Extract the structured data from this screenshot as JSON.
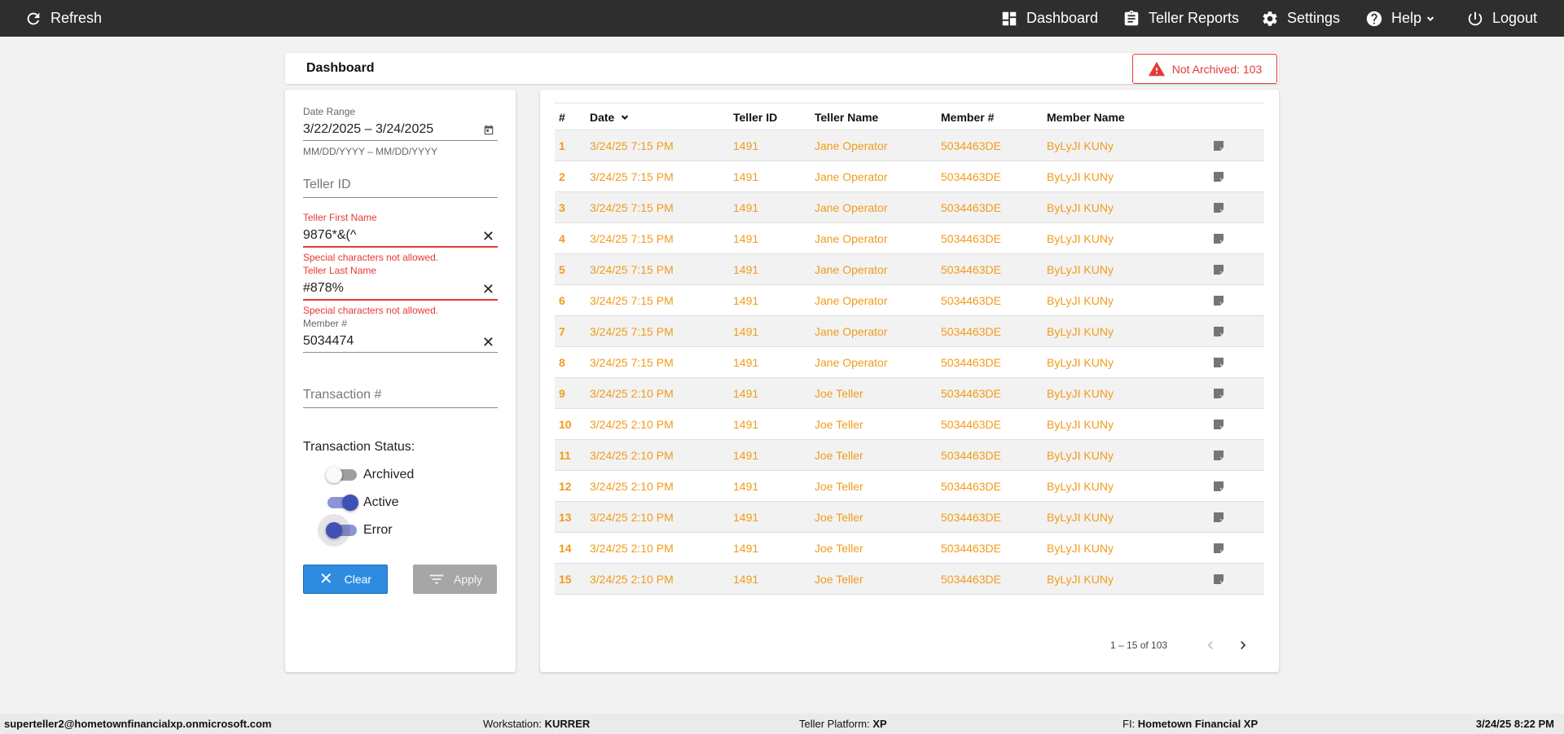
{
  "topbar": {
    "refresh_label": "Refresh",
    "nav": {
      "dashboard": "Dashboard",
      "teller_reports": "Teller Reports",
      "settings": "Settings",
      "help": "Help",
      "logout": "Logout"
    }
  },
  "header": {
    "title": "Dashboard",
    "not_archived": "Not Archived: 103"
  },
  "filters": {
    "date_range": {
      "label": "Date Range",
      "value": "3/22/2025 – 3/24/2025",
      "hint": "MM/DD/YYYY – MM/DD/YYYY"
    },
    "teller_id": {
      "placeholder": "Teller ID"
    },
    "teller_first_name": {
      "label": "Teller First Name",
      "value": "9876*&(^",
      "error": "Special characters not allowed."
    },
    "teller_last_name": {
      "label": "Teller Last Name",
      "value": "#878%",
      "error": "Special characters not allowed."
    },
    "member_number": {
      "label": "Member #",
      "value": "5034474"
    },
    "transaction_number": {
      "placeholder": "Transaction #"
    },
    "status": {
      "title": "Transaction Status:",
      "archived": "Archived",
      "active": "Active",
      "error": "Error"
    },
    "clear_label": "Clear",
    "apply_label": "Apply"
  },
  "table": {
    "columns": {
      "num": "#",
      "date": "Date",
      "teller_id": "Teller ID",
      "teller_name": "Teller Name",
      "member_num": "Member #",
      "member_name": "Member Name"
    },
    "rows": [
      {
        "num": "1",
        "date": "3/24/25 7:15 PM",
        "teller_id": "1491",
        "teller_name": "Jane Operator",
        "member_num": "5034463DE",
        "member_name": "ByLyJI KUNy"
      },
      {
        "num": "2",
        "date": "3/24/25 7:15 PM",
        "teller_id": "1491",
        "teller_name": "Jane Operator",
        "member_num": "5034463DE",
        "member_name": "ByLyJI KUNy"
      },
      {
        "num": "3",
        "date": "3/24/25 7:15 PM",
        "teller_id": "1491",
        "teller_name": "Jane Operator",
        "member_num": "5034463DE",
        "member_name": "ByLyJI KUNy"
      },
      {
        "num": "4",
        "date": "3/24/25 7:15 PM",
        "teller_id": "1491",
        "teller_name": "Jane Operator",
        "member_num": "5034463DE",
        "member_name": "ByLyJI KUNy"
      },
      {
        "num": "5",
        "date": "3/24/25 7:15 PM",
        "teller_id": "1491",
        "teller_name": "Jane Operator",
        "member_num": "5034463DE",
        "member_name": "ByLyJI KUNy"
      },
      {
        "num": "6",
        "date": "3/24/25 7:15 PM",
        "teller_id": "1491",
        "teller_name": "Jane Operator",
        "member_num": "5034463DE",
        "member_name": "ByLyJI KUNy"
      },
      {
        "num": "7",
        "date": "3/24/25 7:15 PM",
        "teller_id": "1491",
        "teller_name": "Jane Operator",
        "member_num": "5034463DE",
        "member_name": "ByLyJI KUNy"
      },
      {
        "num": "8",
        "date": "3/24/25 7:15 PM",
        "teller_id": "1491",
        "teller_name": "Jane Operator",
        "member_num": "5034463DE",
        "member_name": "ByLyJI KUNy"
      },
      {
        "num": "9",
        "date": "3/24/25 2:10 PM",
        "teller_id": "1491",
        "teller_name": "Joe Teller",
        "member_num": "5034463DE",
        "member_name": "ByLyJI KUNy"
      },
      {
        "num": "10",
        "date": "3/24/25 2:10 PM",
        "teller_id": "1491",
        "teller_name": "Joe Teller",
        "member_num": "5034463DE",
        "member_name": "ByLyJI KUNy"
      },
      {
        "num": "11",
        "date": "3/24/25 2:10 PM",
        "teller_id": "1491",
        "teller_name": "Joe Teller",
        "member_num": "5034463DE",
        "member_name": "ByLyJI KUNy"
      },
      {
        "num": "12",
        "date": "3/24/25 2:10 PM",
        "teller_id": "1491",
        "teller_name": "Joe Teller",
        "member_num": "5034463DE",
        "member_name": "ByLyJI KUNy"
      },
      {
        "num": "13",
        "date": "3/24/25 2:10 PM",
        "teller_id": "1491",
        "teller_name": "Joe Teller",
        "member_num": "5034463DE",
        "member_name": "ByLyJI KUNy"
      },
      {
        "num": "14",
        "date": "3/24/25 2:10 PM",
        "teller_id": "1491",
        "teller_name": "Joe Teller",
        "member_num": "5034463DE",
        "member_name": "ByLyJI KUNy"
      },
      {
        "num": "15",
        "date": "3/24/25 2:10 PM",
        "teller_id": "1491",
        "teller_name": "Joe Teller",
        "member_num": "5034463DE",
        "member_name": "ByLyJI KUNy"
      }
    ],
    "pagination": "1 – 15 of 103"
  },
  "footer": {
    "user": "superteller2@hometownfinancialxp.onmicrosoft.com",
    "workstation_label": "Workstation:",
    "workstation": "KURRER",
    "platform_label": "Teller Platform:",
    "platform": "XP",
    "fi_label": "FI:",
    "fi": "Hometown Financial XP",
    "datetime": "3/24/25 8:22 PM"
  },
  "icons": {
    "refresh": "refresh-icon",
    "dashboard": "dashboard-icon",
    "reports": "clipboard-icon",
    "settings": "gear-icon",
    "help": "help-circle-icon",
    "logout": "power-icon",
    "warning": "warning-icon",
    "note": "note-icon"
  },
  "colors": {
    "topbar": "#2e2e2e",
    "row_text": "#f29b1b",
    "error": "#e53935",
    "toggle_active": "#3f51b5",
    "clear_button": "#2d8be0"
  }
}
